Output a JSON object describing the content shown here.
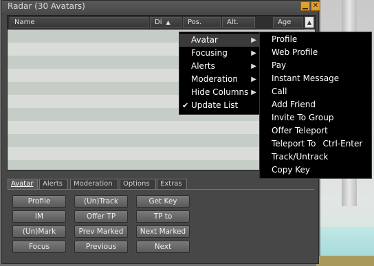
{
  "window": {
    "title": "Radar (30 Avatars)",
    "minimize_glyph": "▁",
    "close_glyph": "✕"
  },
  "list": {
    "columns": [
      "Name",
      "Di",
      "Pos.",
      "Alt.",
      "Age"
    ],
    "sort_indicator": "▲",
    "scroll_up_glyph": "▲"
  },
  "tabs": [
    "Avatar",
    "Alerts",
    "Moderation",
    "Options",
    "Extras"
  ],
  "buttons": {
    "profile": "Profile",
    "untrack": "(Un)Track",
    "get_key": "Get Key",
    "im": "IM",
    "offer_tp": "Offer TP",
    "tp_to": "TP to",
    "unmark": "(Un)Mark",
    "prev_marked": "Prev Marked",
    "next_marked": "Next Marked",
    "focus": "Focus",
    "previous": "Previous",
    "next": "Next"
  },
  "menu": {
    "items": [
      {
        "label": "Avatar",
        "arrow": "▶"
      },
      {
        "label": "Focusing",
        "arrow": "▶"
      },
      {
        "label": "Alerts",
        "arrow": "▶"
      },
      {
        "label": "Moderation",
        "arrow": "▶"
      },
      {
        "label": "Hide Columns",
        "arrow": "▶"
      },
      {
        "label": "Update List",
        "check": "✔"
      }
    ]
  },
  "submenu": {
    "items": [
      "Profile",
      "Web Profile",
      "Pay",
      "Instant Message",
      "Call",
      "Add Friend",
      "Invite To Group",
      "Offer Teleport",
      "Teleport To",
      "Track/Untrack",
      "Copy Key"
    ],
    "teleport_shortcut": "Ctrl-Enter"
  }
}
